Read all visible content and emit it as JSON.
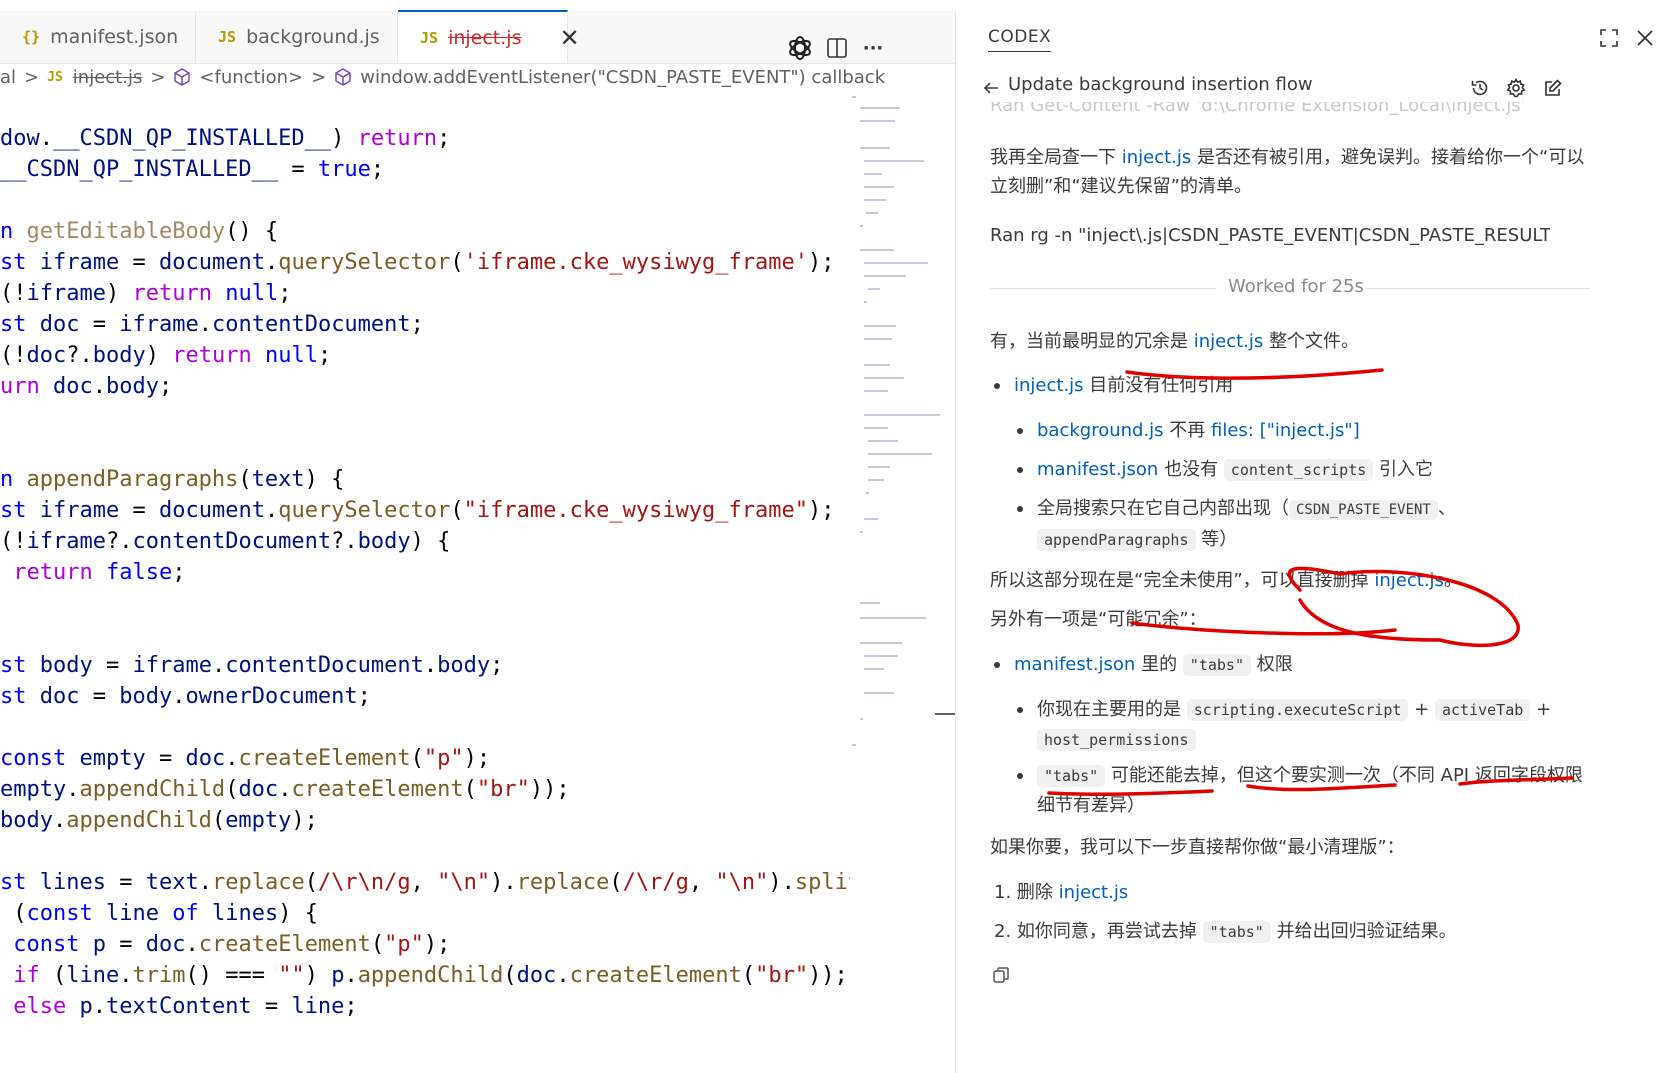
{
  "editor": {
    "tabs": [
      {
        "icon": "{}",
        "label": "manifest.json"
      },
      {
        "icon": "JS",
        "label": "background.js"
      },
      {
        "icon": "JS",
        "label": "inject.js",
        "active": true
      }
    ],
    "close_glyph": "✕",
    "more_glyph": "···",
    "breadcrumb": {
      "folder": "al",
      "file_icon": "JS",
      "file": "inject.js",
      "func": "<function>",
      "callback": "window.addEventListener(\"CSDN_PASTE_EVENT\") callback"
    }
  },
  "codex": {
    "title": "CODEX",
    "thread_title": "Update background insertion flow",
    "faded_line": "Ran Get-Content -Raw 'd:\\Chrome Extension_Local\\inject.js'",
    "msg1_prefix": "我再全局查一下 ",
    "msg1_link": "inject.js",
    "msg1_suffix": " 是否还有被引用，避免误判。接着给你一个“可以立刻删”和“建议先保留”的清单。",
    "ran_cmd": "Ran rg -n \"inject\\.js|CSDN_PASTE_EVENT|CSDN_PASTE_RESULT|__CSD...",
    "worked": "Worked for 25s",
    "ans1_prefix": "有，当前最明显的冗余是 ",
    "ans1_link": "inject.js",
    "ans1_suffix": " 整个文件。",
    "b1_link": "inject.js",
    "b1_text": " 目前没有任何引用",
    "b1a_link": "background.js",
    "b1a_text": " 不再 ",
    "b1a_link2": "files: [\"inject.js\"]",
    "b1b_link": "manifest.json",
    "b1b_text": " 也没有 ",
    "b1b_code": "content_scripts",
    "b1b_text2": " 引入它",
    "b1c_text": "全局搜索只在它自己内部出现（",
    "b1c_code1": "CSDN_PASTE_EVENT",
    "b1c_text2": "、",
    "b1c_code2": "appendParagraphs",
    "b1c_text3": " 等）",
    "so_prefix": "所以这部分现在是“完全未使用”，可以直接删掉 ",
    "so_link": "inject.js",
    "so_suffix": "。",
    "another": "另外有一项是“可能冗余”：",
    "b2_link": "manifest.json",
    "b2_text": " 里的 ",
    "b2_code": "\"tabs\"",
    "b2_text2": " 权限",
    "b2a_text": "你现在主要用的是 ",
    "b2a_code1": "scripting.executeScript",
    "b2a_plus": " + ",
    "b2a_code2": "activeTab",
    "b2a_code3": "host_permissions",
    "b2b_code": "\"tabs\"",
    "b2b_text": " 可能还能去掉，但这个要实测一次（不同 API 返回字段权限细节有差异）",
    "ifyou": "如果你要，我可以下一步直接帮你做“最小清理版”：",
    "step1_num": "1.",
    "step1_text": "删除 ",
    "step1_link": "inject.js",
    "step2_num": "2.",
    "step2_text": "如你同意，再尝试去掉 ",
    "step2_code": "\"tabs\"",
    "step2_text2": " 并给出回归验证结果。"
  },
  "colors": {
    "accent": "#005fb8",
    "annotation": "#e00000",
    "keyword": "#af00db",
    "string": "#a31515",
    "function": "#795e26",
    "variable": "#001080"
  }
}
